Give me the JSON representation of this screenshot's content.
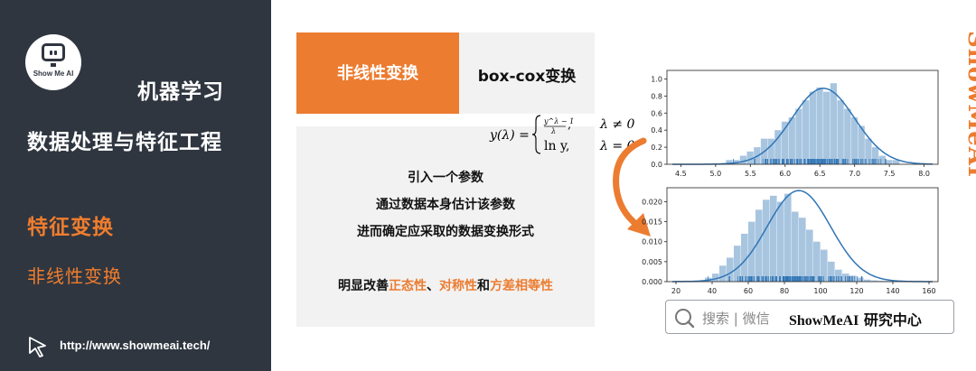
{
  "sidebar": {
    "logo_text": "Show Me AI",
    "course": "机器学习",
    "module": "数据处理与特征工程",
    "section": "特征变换",
    "subsection": "非线性变换",
    "url": "http://www.showmeai.tech/"
  },
  "slide": {
    "tag": "非线性变换",
    "title": "box-cox变换",
    "formula": {
      "lhs": "y(λ) =",
      "case1_expr_num": "y^λ − 1",
      "case1_expr_den": "λ",
      "case1_cond": "λ ≠ 0",
      "case2_expr": "ln y,",
      "case2_cond": "λ = 0"
    },
    "lines": [
      "引入一个参数",
      "通过数据本身估计该参数",
      "进而确定应采取的数据变换形式"
    ],
    "summary": {
      "prefix": "明显改善",
      "h1": "正态性",
      "sep1": "、",
      "h2": "对称性",
      "sep2": "和",
      "h3": "方差相等性"
    }
  },
  "search": {
    "placeholder": "搜索 | 微信",
    "brand": "ShowMeAI",
    "brand_suffix": " 研究中心"
  },
  "watermark": "ShowMeAI",
  "colors": {
    "accent": "#ec7c30",
    "sidebar_bg": "#2f3640",
    "bar": "#a8c5e0",
    "kde": "#2f75b5"
  },
  "chart_data": [
    {
      "type": "bar",
      "title": "",
      "xlabel": "",
      "ylabel": "",
      "xlim": [
        4.3,
        8.2
      ],
      "ylim": [
        0,
        1.1
      ],
      "x_ticks": [
        "4.5",
        "5.0",
        "5.5",
        "6.0",
        "6.5",
        "7.0",
        "7.5",
        "8.0"
      ],
      "y_ticks": [
        "0.0",
        "0.2",
        "0.4",
        "0.6",
        "0.8",
        "1.0"
      ],
      "bin_start": 5.15,
      "bin_width": 0.1,
      "values": [
        0.05,
        0.05,
        0.1,
        0.15,
        0.2,
        0.3,
        0.3,
        0.4,
        0.5,
        0.55,
        0.65,
        0.75,
        0.85,
        0.9,
        0.85,
        0.95,
        0.75,
        0.65,
        0.55,
        0.45,
        0.3,
        0.2,
        0.1,
        0.05,
        0.05
      ],
      "kde": {
        "mean": 6.55,
        "sd": 0.45,
        "peak": 0.89
      },
      "has_rug": true
    },
    {
      "type": "bar",
      "title": "",
      "xlabel": "",
      "ylabel": "",
      "xlim": [
        15,
        165
      ],
      "ylim": [
        0,
        0.0235
      ],
      "x_ticks": [
        "20",
        "40",
        "60",
        "80",
        "100",
        "120",
        "140",
        "160"
      ],
      "y_ticks": [
        "0.000",
        "0.005",
        "0.010",
        "0.015",
        "0.020"
      ],
      "bin_start": 36,
      "bin_width": 4,
      "values": [
        0.001,
        0.002,
        0.004,
        0.006,
        0.009,
        0.012,
        0.015,
        0.018,
        0.0205,
        0.0215,
        0.02,
        0.022,
        0.0175,
        0.016,
        0.013,
        0.01,
        0.008,
        0.005,
        0.003,
        0.002,
        0.0015,
        0.001,
        0.0005,
        0.0003,
        0.0002,
        0.0002
      ],
      "kde": {
        "mean": 88,
        "sd": 17.5,
        "peak": 0.0228
      },
      "has_rug": true
    }
  ]
}
